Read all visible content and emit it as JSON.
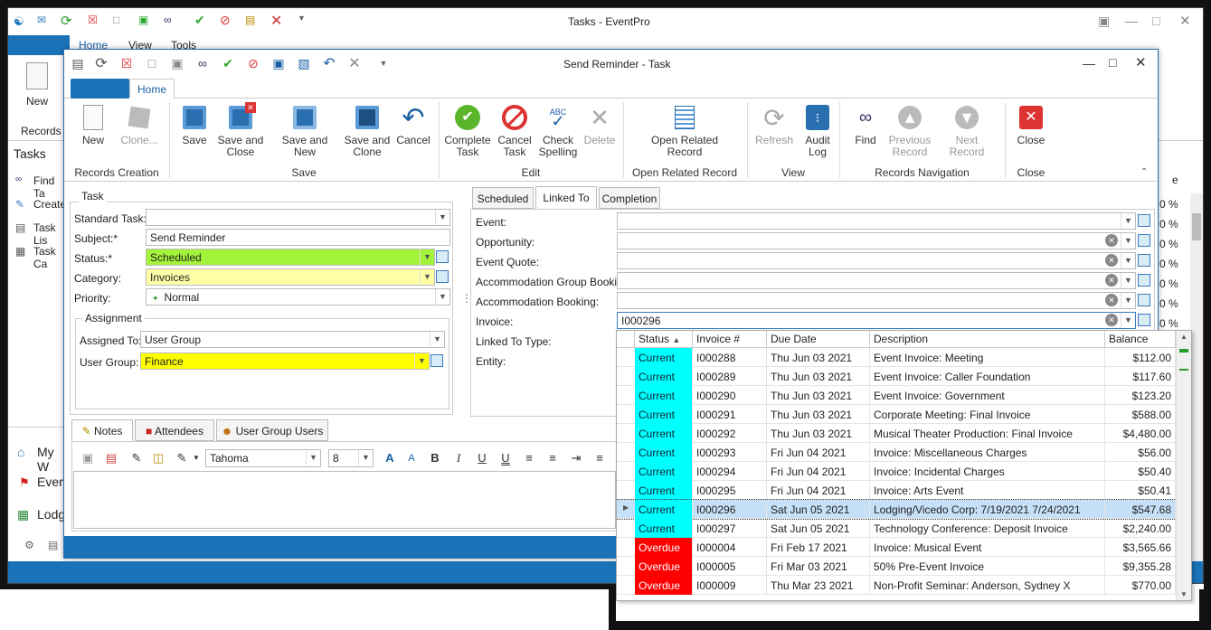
{
  "colors": {
    "accent": "#1a73b8",
    "status_current": "#00ffff",
    "status_overdue": "#ff0000",
    "status_scheduled": "#a3f33a",
    "category_bg": "#ffffa8",
    "usergroup_bg": "#ffff00",
    "selected_row": "#c5e0f7"
  },
  "background": {
    "title": "Tasks - EventPro",
    "tabs": [
      "Home",
      "View",
      "Tools"
    ],
    "new_label": "New",
    "records_group": "Records C",
    "sidebar_title": "Tasks",
    "sidebar_items": [
      "Find Ta",
      "Create",
      "Task Lis",
      "Task Ca"
    ],
    "nav_items": [
      "My W",
      "Even",
      "Lodg"
    ],
    "pct_values": [
      "0 %",
      "0 %",
      "0 %",
      "0 %",
      "0 %",
      "0 %",
      "0 %"
    ]
  },
  "window": {
    "title": "Send Reminder - Task",
    "tab_home": "Home"
  },
  "ribbon": {
    "buttons": [
      {
        "name": "new",
        "l1": "New",
        "l2": "",
        "icon": "new-document-icon",
        "dim": false
      },
      {
        "name": "clone",
        "l1": "Clone...",
        "l2": "",
        "icon": "clone-icon",
        "dim": true
      },
      {
        "name": "save",
        "l1": "Save",
        "l2": "",
        "icon": "save-icon",
        "dim": false
      },
      {
        "name": "save-and-close",
        "l1": "Save and",
        "l2": "Close",
        "icon": "save-close-icon",
        "dim": false
      },
      {
        "name": "save-and-new",
        "l1": "Save and New",
        "l2": "",
        "icon": "save-new-icon",
        "dim": false
      },
      {
        "name": "save-and-clone",
        "l1": "Save and",
        "l2": "Clone",
        "icon": "save-clone-icon",
        "dim": false
      },
      {
        "name": "cancel",
        "l1": "Cancel",
        "l2": "",
        "icon": "undo-icon",
        "dim": false
      },
      {
        "name": "complete-task",
        "l1": "Complete",
        "l2": "Task",
        "icon": "check-circle-icon",
        "dim": false
      },
      {
        "name": "cancel-task",
        "l1": "Cancel",
        "l2": "Task",
        "icon": "no-entry-icon",
        "dim": false
      },
      {
        "name": "check-spelling",
        "l1": "Check",
        "l2": "Spelling",
        "icon": "spellcheck-icon",
        "dim": false
      },
      {
        "name": "delete",
        "l1": "Delete",
        "l2": "",
        "icon": "x-icon",
        "dim": true
      },
      {
        "name": "open-related-record",
        "l1": "Open Related",
        "l2": "Record",
        "icon": "related-record-icon",
        "dim": false
      },
      {
        "name": "refresh",
        "l1": "Refresh",
        "l2": "",
        "icon": "refresh-icon",
        "dim": true
      },
      {
        "name": "audit-log",
        "l1": "Audit",
        "l2": "Log",
        "icon": "footprints-icon",
        "dim": false
      },
      {
        "name": "find",
        "l1": "Find",
        "l2": "",
        "icon": "binoculars-icon",
        "dim": false
      },
      {
        "name": "previous-record",
        "l1": "Previous",
        "l2": "Record",
        "icon": "arrow-up-icon",
        "dim": true
      },
      {
        "name": "next-record",
        "l1": "Next Record",
        "l2": "",
        "icon": "arrow-down-icon",
        "dim": true
      },
      {
        "name": "close",
        "l1": "Close",
        "l2": "",
        "icon": "close-red-icon",
        "dim": false
      }
    ],
    "groups": [
      "Records Creation",
      "Save",
      "Edit",
      "Open Related Record",
      "View",
      "Records Navigation",
      "Close"
    ]
  },
  "task": {
    "section": "Task",
    "standard_task_label": "Standard Task:",
    "standard_task_value": "",
    "subject_label": "Subject:*",
    "subject_value": "Send Reminder",
    "status_label": "Status:*",
    "status_value": "Scheduled",
    "category_label": "Category:",
    "category_value": "Invoices",
    "priority_label": "Priority:",
    "priority_value": "Normal",
    "assignment_section": "Assignment",
    "assigned_to_label": "Assigned To:",
    "assigned_to_value": "User Group",
    "user_group_label": "User Group:",
    "user_group_value": "Finance"
  },
  "bottom_tabs": [
    "Notes",
    "Attendees",
    "User Group Users"
  ],
  "editor": {
    "font": "Tahoma",
    "size": "8"
  },
  "linked": {
    "tabs": [
      "Scheduled",
      "Linked To",
      "Completion"
    ],
    "event_label": "Event:",
    "opportunity_label": "Opportunity:",
    "event_quote_label": "Event Quote:",
    "acc_group_label": "Accommodation Group Booking:",
    "acc_booking_label": "Accommodation Booking:",
    "invoice_label": "Invoice:",
    "invoice_value": "I000296",
    "linked_type_label": "Linked To Type:",
    "entity_label": "Entity:"
  },
  "grid": {
    "columns": [
      "Status",
      "Invoice #",
      "Due Date",
      "Description",
      "Balance"
    ],
    "rows": [
      {
        "status": "Current",
        "inv": "I000288",
        "due": "Thu Jun 03 2021",
        "desc": "Event Invoice: Meeting",
        "bal": "$112.00"
      },
      {
        "status": "Current",
        "inv": "I000289",
        "due": "Thu Jun 03 2021",
        "desc": "Event Invoice: Caller Foundation",
        "bal": "$117.60"
      },
      {
        "status": "Current",
        "inv": "I000290",
        "due": "Thu Jun 03 2021",
        "desc": "Event Invoice: Government",
        "bal": "$123.20"
      },
      {
        "status": "Current",
        "inv": "I000291",
        "due": "Thu Jun 03 2021",
        "desc": "Corporate Meeting: Final Invoice",
        "bal": "$588.00"
      },
      {
        "status": "Current",
        "inv": "I000292",
        "due": "Thu Jun 03 2021",
        "desc": "Musical Theater Production: Final Invoice",
        "bal": "$4,480.00"
      },
      {
        "status": "Current",
        "inv": "I000293",
        "due": "Fri Jun 04 2021",
        "desc": "Invoice: Miscellaneous Charges",
        "bal": "$56.00"
      },
      {
        "status": "Current",
        "inv": "I000294",
        "due": "Fri Jun 04 2021",
        "desc": "Invoice: Incidental Charges",
        "bal": "$50.40"
      },
      {
        "status": "Current",
        "inv": "I000295",
        "due": "Fri Jun 04 2021",
        "desc": "Invoice: Arts Event",
        "bal": "$50.41"
      },
      {
        "status": "Current",
        "inv": "I000296",
        "due": "Sat Jun 05 2021",
        "desc": "Lodging/Vicedo Corp: 7/19/2021 7/24/2021",
        "bal": "$547.68"
      },
      {
        "status": "Current",
        "inv": "I000297",
        "due": "Sat Jun 05 2021",
        "desc": "Technology Conference: Deposit Invoice",
        "bal": "$2,240.00"
      },
      {
        "status": "Overdue",
        "inv": "I000004",
        "due": "Fri Feb 17 2021",
        "desc": "Invoice: Musical Event",
        "bal": "$3,565.66"
      },
      {
        "status": "Overdue",
        "inv": "I000005",
        "due": "Fri Mar 03 2021",
        "desc": "50% Pre-Event Invoice",
        "bal": "$9,355.28"
      },
      {
        "status": "Overdue",
        "inv": "I000009",
        "due": "Thu Mar 23 2021",
        "desc": "Non-Profit Seminar: Anderson, Sydney X",
        "bal": "$770.00"
      }
    ],
    "selected_index": 8
  }
}
